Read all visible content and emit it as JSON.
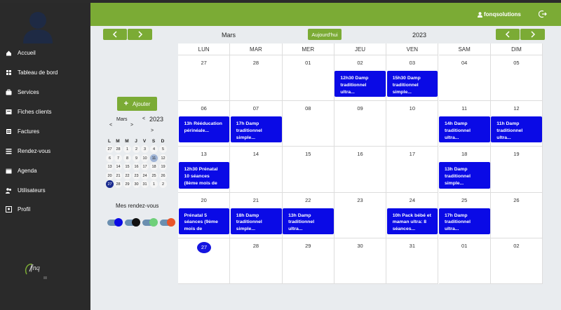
{
  "header": {
    "user": "fonqsolutions"
  },
  "sidebar": {
    "items": [
      {
        "label": "Accueil",
        "icon": "home-icon"
      },
      {
        "label": "Tableau de bord",
        "icon": "dashboard-icon"
      },
      {
        "label": "Services",
        "icon": "briefcase-icon"
      },
      {
        "label": "Fiches clients",
        "icon": "client-card-icon"
      },
      {
        "label": "Factures",
        "icon": "invoice-icon"
      },
      {
        "label": "Rendez-vous",
        "icon": "list-icon"
      },
      {
        "label": "Agenda",
        "icon": "calendar-icon"
      },
      {
        "label": "Utilisateurs",
        "icon": "users-icon"
      },
      {
        "label": "Profil",
        "icon": "profile-icon"
      }
    ],
    "logo_text": "fnq"
  },
  "toolbar": {
    "month": "Mars",
    "today": "Aujourd'hui",
    "year": "2023"
  },
  "add_button": "Ajouter",
  "mini_calendar": {
    "month": "Mars",
    "year": "2023",
    "prev": "<",
    "next": ">",
    "year_prev": "<",
    "year_next": ">",
    "days_header": [
      "L",
      "M",
      "M",
      "J",
      "V",
      "S",
      "D"
    ],
    "weeks": [
      [
        "27",
        "28",
        "1",
        "2",
        "3",
        "4",
        "5"
      ],
      [
        "6",
        "7",
        "8",
        "9",
        "10",
        "11",
        "12"
      ],
      [
        "13",
        "14",
        "15",
        "16",
        "17",
        "18",
        "19"
      ],
      [
        "20",
        "21",
        "22",
        "23",
        "24",
        "25",
        "26"
      ],
      [
        "27",
        "28",
        "29",
        "30",
        "31",
        "1",
        "2"
      ]
    ],
    "selected": "11",
    "today": "27"
  },
  "mes_rendez_vous": "Mes rendez-vous",
  "toggle_colors": [
    "#0a0ae6",
    "#111111",
    "#6fd07a",
    "#e8542a"
  ],
  "calendar": {
    "headers": [
      "LUN",
      "MAR",
      "MER",
      "JEU",
      "VEN",
      "SAM",
      "DIM"
    ],
    "weeks": [
      [
        "27",
        "28",
        "01",
        "02",
        "03",
        "04",
        "05"
      ],
      [
        "06",
        "07",
        "08",
        "09",
        "10",
        "11",
        "12"
      ],
      [
        "13",
        "14",
        "15",
        "16",
        "17",
        "18",
        "19"
      ],
      [
        "20",
        "21",
        "22",
        "23",
        "24",
        "25",
        "26"
      ],
      [
        "27",
        "28",
        "29",
        "30",
        "31",
        "01",
        "02"
      ]
    ],
    "today": "27",
    "events": [
      {
        "week": 0,
        "day": 3,
        "text": "12h30 Damp traditionnel ultra..."
      },
      {
        "week": 0,
        "day": 4,
        "text": "15h30 Damp traditionnel simple..."
      },
      {
        "week": 1,
        "day": 0,
        "text": "13h Rééducation périnéale..."
      },
      {
        "week": 1,
        "day": 1,
        "text": "17h Damp traditionnel simple..."
      },
      {
        "week": 1,
        "day": 5,
        "text": "14h Damp traditionnel ultra..."
      },
      {
        "week": 1,
        "day": 6,
        "text": "11h Damp traditionnel ultra..."
      },
      {
        "week": 2,
        "day": 0,
        "text": "12h30 Prénatal 10 séances (8ème mois de"
      },
      {
        "week": 2,
        "day": 5,
        "text": "13h Damp traditionnel simple..."
      },
      {
        "week": 3,
        "day": 0,
        "text": "Prénatal 5 séances (9ème mois de"
      },
      {
        "week": 3,
        "day": 1,
        "text": "18h Damp traditionnel simple..."
      },
      {
        "week": 3,
        "day": 2,
        "text": "13h Damp traditionnel ultra..."
      },
      {
        "week": 3,
        "day": 4,
        "text": "10h Pack bébé et maman ultra: 8 séances..."
      },
      {
        "week": 3,
        "day": 5,
        "text": "17h Damp traditionnel ultra..."
      }
    ]
  },
  "colors": {
    "accent": "#7bab35",
    "sidebar": "#2a2a2a",
    "event": "#0a0ae6"
  }
}
